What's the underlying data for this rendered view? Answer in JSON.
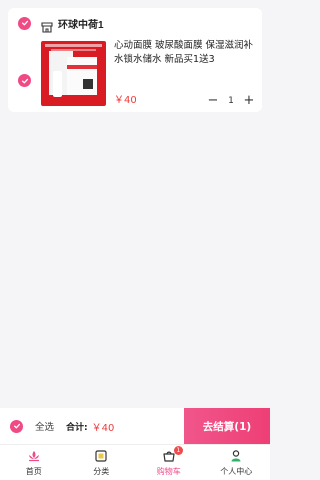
{
  "store": {
    "name": "环球中荷1",
    "icon": "store-icon",
    "selected": true
  },
  "item": {
    "selected": true,
    "title": "心动面膜 玻尿酸面膜 保湿滋润补水锁水储水 新品买1送3",
    "price": "￥40",
    "quantity": "1",
    "minus_label": "−",
    "plus_label": "+"
  },
  "checkout": {
    "select_all_label": "全选",
    "total_label": "合计:",
    "total_value": "￥40",
    "button_label": "去结算(1)"
  },
  "tabbar": {
    "tabs": [
      {
        "label": "首页",
        "icon": "home-lotus-icon",
        "active": false
      },
      {
        "label": "分类",
        "icon": "category-icon",
        "active": false
      },
      {
        "label": "购物车",
        "icon": "cart-icon",
        "active": true,
        "badge": "1"
      },
      {
        "label": "个人中心",
        "icon": "profile-icon",
        "active": false
      }
    ]
  },
  "colors": {
    "accent": "#f04a85",
    "price": "#f03c3c",
    "background": "#f5f5f7"
  }
}
